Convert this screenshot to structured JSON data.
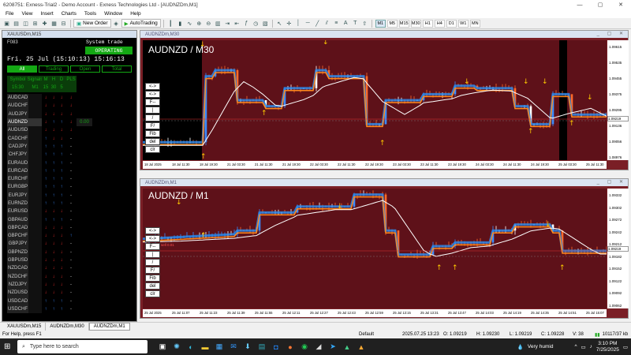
{
  "window": {
    "title": "6208751: Exness-Trial2 - Demo Account - Exness Technologies Ltd - [AUDNZDm,M1]",
    "controls": [
      "—",
      "▢",
      "✕"
    ]
  },
  "menu": [
    "File",
    "View",
    "Insert",
    "Charts",
    "Tools",
    "Window",
    "Help"
  ],
  "toolbar": {
    "new_order": "New Order",
    "autotrading": "AutoTrading",
    "timeframes": [
      "M1",
      "M5",
      "M15",
      "M30",
      "H1",
      "H4",
      "D1",
      "W1",
      "MN"
    ],
    "selected_tf": "M1"
  },
  "panel": {
    "title": "XAUUSDm,M15",
    "account": "F083",
    "system_trade": "System trade",
    "status": "OPERATING",
    "date": "Fri. 25 Jul (15:10:13) 15:16:13",
    "filters": [
      "All",
      "Trading",
      "Open",
      "Total"
    ],
    "headers": [
      "Symbol",
      "Signals",
      "M",
      "H",
      "D",
      "PLS"
    ],
    "subheaders": [
      "15:30",
      "M1",
      "15",
      "30",
      "5",
      ""
    ],
    "rows": [
      {
        "sym": "AUDCAD",
        "c": "↓",
        "d": "↓",
        "e": "↓",
        "f": "↓",
        "pl": ""
      },
      {
        "sym": "AUDCHF",
        "c": "↓",
        "d": "↓",
        "e": "↓",
        "f": "↓",
        "pl": ""
      },
      {
        "sym": "AUDJPY",
        "c": "↓",
        "d": "↓",
        "e": "↓",
        "f": "↓",
        "pl": ""
      },
      {
        "sym": "AUDNZD",
        "c": "↓",
        "d": "↑",
        "e": "↑",
        "f": "↓",
        "pl": "0.00"
      },
      {
        "sym": "AUDUSD",
        "c": "↓",
        "d": "↓",
        "e": "↓",
        "f": "↓",
        "pl": ""
      },
      {
        "sym": "CADCHF",
        "c": "↑",
        "d": "↓",
        "e": "↓",
        "f": "-",
        "pl": ""
      },
      {
        "sym": "CADJPY",
        "c": "↑",
        "d": "↑",
        "e": "↑",
        "f": "-",
        "pl": ""
      },
      {
        "sym": "CHFJPY",
        "c": "↑",
        "d": "↑",
        "e": "↑",
        "f": "-",
        "pl": ""
      },
      {
        "sym": "EURAUD",
        "c": "↑",
        "d": "↑",
        "e": "↑",
        "f": "-",
        "pl": ""
      },
      {
        "sym": "EURCAD",
        "c": "↑",
        "d": "↑",
        "e": "↑",
        "f": "-",
        "pl": ""
      },
      {
        "sym": "EURCHF",
        "c": "↑",
        "d": "↑",
        "e": "↑",
        "f": "-",
        "pl": ""
      },
      {
        "sym": "EURGBP",
        "c": "↑",
        "d": "↑",
        "e": "↑",
        "f": "-",
        "pl": ""
      },
      {
        "sym": "EURJPY",
        "c": "↑",
        "d": "↑",
        "e": "↑",
        "f": "-",
        "pl": ""
      },
      {
        "sym": "EURNZD",
        "c": "↑",
        "d": "↑",
        "e": "↑",
        "f": "-",
        "pl": ""
      },
      {
        "sym": "EURUSD",
        "c": "↓",
        "d": "↓",
        "e": "↓",
        "f": "-",
        "pl": ""
      },
      {
        "sym": "GBPAUD",
        "c": "↑",
        "d": "↑",
        "e": "↑",
        "f": "-",
        "pl": ""
      },
      {
        "sym": "GBPCAD",
        "c": "↓",
        "d": "↓",
        "e": "↓",
        "f": "-",
        "pl": ""
      },
      {
        "sym": "GBPCHF",
        "c": "↓",
        "d": "↓",
        "e": "↓",
        "f": "↑",
        "pl": ""
      },
      {
        "sym": "GBPJPY",
        "c": "↓",
        "d": "↓",
        "e": "↓",
        "f": "-",
        "pl": ""
      },
      {
        "sym": "GBPNZD",
        "c": "↓",
        "d": "↓",
        "e": "↓",
        "f": "-",
        "pl": ""
      },
      {
        "sym": "GBPUSD",
        "c": "↓",
        "d": "↓",
        "e": "↓",
        "f": "-",
        "pl": ""
      },
      {
        "sym": "NZDCAD",
        "c": "↓",
        "d": "↓",
        "e": "↓",
        "f": "-",
        "pl": ""
      },
      {
        "sym": "NZDCHF",
        "c": "↓",
        "d": "↓",
        "e": "↓",
        "f": "-",
        "pl": ""
      },
      {
        "sym": "NZDJPY",
        "c": "↓",
        "d": "↓",
        "e": "↓",
        "f": "-",
        "pl": ""
      },
      {
        "sym": "NZDUSD",
        "c": "↓",
        "d": "↓",
        "e": "↓",
        "f": "-",
        "pl": ""
      },
      {
        "sym": "USDCAD",
        "c": "↑",
        "d": "↑",
        "e": "↑",
        "f": "-",
        "pl": ""
      },
      {
        "sym": "USDCHF",
        "c": "↑",
        "d": "↑",
        "e": "↑",
        "f": "-",
        "pl": ""
      }
    ]
  },
  "chart1": {
    "window_title": "AUDNZDm,M30",
    "label": "AUDNZD / M30",
    "yticks": [
      "1.09615",
      "1.09535",
      "1.09455",
      "1.09375",
      "1.09295",
      "1.09136",
      "1.09056",
      "1.08976"
    ],
    "xticks": [
      "18 Jul 2025",
      "18 Jul 11:30",
      "18 Jul 19:30",
      "21 Jul 03:30",
      "21 Jul 11:30",
      "21 Jul 19:30",
      "22 Jul 03:30",
      "22 Jul 11:30",
      "22 Jul 19:30",
      "23 Jul 03:30",
      "23 Jul 11:30",
      "23 Jul 19:30",
      "24 Jul 03:30",
      "24 Jul 11:30",
      "24 Jul 19:30",
      "25 Jul 03:30",
      "25 Jul 11:30"
    ],
    "price_tag": "1.09219",
    "tools": [
      "<->",
      "<->",
      "F--",
      "|",
      "/",
      "F/",
      "Fib",
      "del",
      "clr"
    ]
  },
  "chart2": {
    "window_title": "AUDNZDm,M1",
    "label": "AUDNZD / M1",
    "yticks": [
      "1.09332",
      "1.09302",
      "1.09272",
      "1.09242",
      "1.09212",
      "1.09182",
      "1.09152",
      "1.09122",
      "1.09092",
      "1.09062"
    ],
    "xticks": [
      "25 Jul 2025",
      "25 Jul 11:07",
      "25 Jul 11:23",
      "25 Jul 11:39",
      "25 Jul 11:55",
      "25 Jul 12:11",
      "25 Jul 12:27",
      "25 Jul 12:43",
      "25 Jul 12:59",
      "25 Jul 13:15",
      "25 Jul 13:31",
      "25 Jul 13:47",
      "25 Jul 14:03",
      "25 Jul 14:19",
      "25 Jul 14:35",
      "25 Jul 14:51",
      "25 Jul 15:07"
    ],
    "price_tag": "1.09219",
    "order_note": "sell 0.01",
    "tools": [
      "<->",
      "<->",
      "F--",
      "|",
      "/",
      "F/",
      "Fib",
      "del",
      "clr"
    ]
  },
  "tabs": [
    "XAUUSDm,M15",
    "AUDNZDm,M30",
    "AUDNZDm,M1"
  ],
  "active_tab": "AUDNZDm,M1",
  "status": {
    "help": "For Help, press F1",
    "profile": "Default",
    "datetime": "2025.07.25 13:23",
    "o": "O: 1.09219",
    "h": "H: 1.09230",
    "l": "L: 1.09219",
    "c": "C: 1.09228",
    "v": "V: 38",
    "conn": "10117/37 kb"
  },
  "taskbar": {
    "search": "Type here to search",
    "weather": "Very humid",
    "time": "3:10 PM",
    "date": "7/25/2025"
  },
  "colors": {
    "bg": "#5e1119",
    "up": "#2a86e6",
    "down": "#ff8a1f",
    "ma": "#ffffff",
    "arrow": "#ffcc00"
  }
}
